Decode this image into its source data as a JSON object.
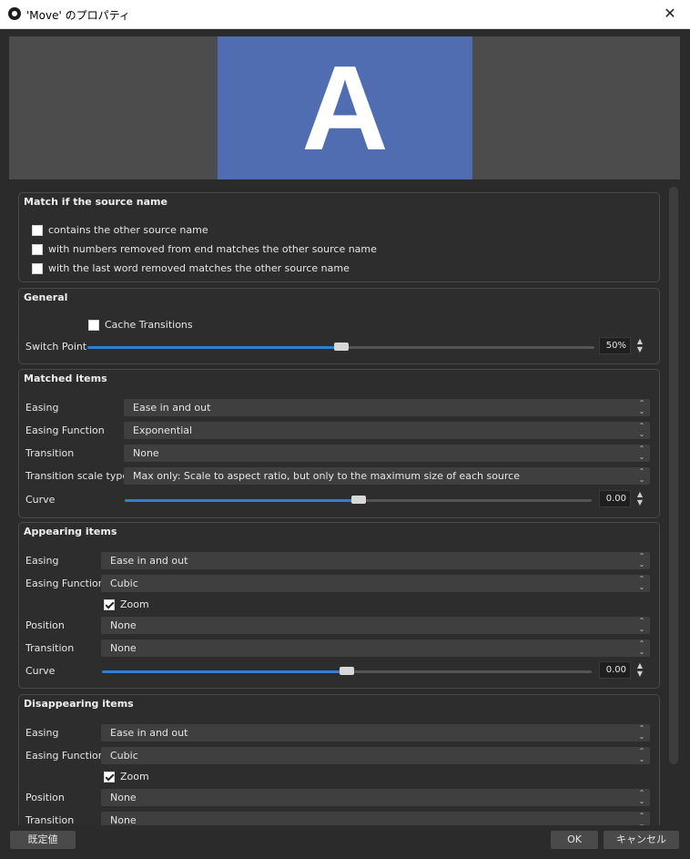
{
  "window": {
    "title": "'Move' のプロパティ",
    "close_glyph": "✕"
  },
  "preview": {
    "letter": "A",
    "color": "#4f6db0"
  },
  "groups": {
    "match": {
      "title": "Match if the source name",
      "options": [
        {
          "label": "contains the other source name",
          "checked": false
        },
        {
          "label": "with numbers removed from end matches the other source name",
          "checked": false
        },
        {
          "label": "with the last word removed matches the other source name",
          "checked": false
        }
      ]
    },
    "general": {
      "title": "General",
      "cache_label": "Cache Transitions",
      "cache_checked": false,
      "switch_label": "Switch Point",
      "switch_value": "50%",
      "switch_fraction": 0.5
    },
    "matched": {
      "title": "Matched items",
      "easing_label": "Easing",
      "easing_value": "Ease in and out",
      "function_label": "Easing Function",
      "function_value": "Exponential",
      "transition_label": "Transition",
      "transition_value": "None",
      "scale_label": "Transition scale type",
      "scale_value": "Max only: Scale to aspect ratio, but only to the maximum size of each source",
      "curve_label": "Curve",
      "curve_value": "0.00",
      "curve_fraction": 0.5
    },
    "appearing": {
      "title": "Appearing items",
      "easing_label": "Easing",
      "easing_value": "Ease in and out",
      "function_label": "Easing Function",
      "function_value": "Cubic",
      "zoom_label": "Zoom",
      "zoom_checked": true,
      "position_label": "Position",
      "position_value": "None",
      "transition_label": "Transition",
      "transition_value": "None",
      "curve_label": "Curve",
      "curve_value": "0.00",
      "curve_fraction": 0.5
    },
    "disappearing": {
      "title": "Disappearing items",
      "easing_label": "Easing",
      "easing_value": "Ease in and out",
      "function_label": "Easing Function",
      "function_value": "Cubic",
      "zoom_label": "Zoom",
      "zoom_checked": true,
      "position_label": "Position",
      "position_value": "None",
      "transition_label": "Transition",
      "transition_value": "None"
    }
  },
  "footer": {
    "defaults": "既定値",
    "ok": "OK",
    "cancel": "キャンセル"
  }
}
